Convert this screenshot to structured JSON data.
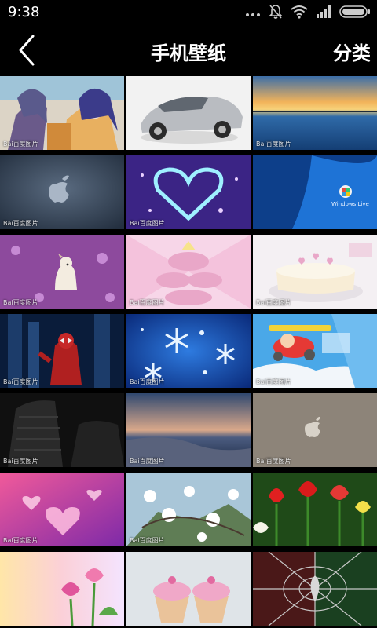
{
  "status_bar": {
    "time": "9:38",
    "icons": [
      "more-dots-icon",
      "mute-bell-icon",
      "wifi-icon",
      "signal-icon",
      "battery-icon"
    ]
  },
  "nav": {
    "back_icon": "chevron-left-icon",
    "title": "手机壁纸",
    "category_label": "分类"
  },
  "wallpapers": [
    {
      "subject": "anime-girls",
      "watermark": "Bai百度图片"
    },
    {
      "subject": "silver-sports-car",
      "watermark": ""
    },
    {
      "subject": "ocean-sunset-reflection",
      "watermark": "Bai百度图片"
    },
    {
      "subject": "apple-logo-gray",
      "watermark": "Bai百度图片"
    },
    {
      "subject": "glowing-heart",
      "watermark": "Bai百度图片"
    },
    {
      "subject": "windows-live-blue",
      "watermark": "",
      "caption": "Windows Live"
    },
    {
      "subject": "dog-in-flowers",
      "watermark": "Bai百度图片"
    },
    {
      "subject": "pink-cartoon-castle",
      "watermark": "Bai百度图片"
    },
    {
      "subject": "heart-cake",
      "watermark": "Bai百度图片"
    },
    {
      "subject": "spiderman-city",
      "watermark": "Bai百度图片"
    },
    {
      "subject": "snowflakes-blue",
      "watermark": "Bai百度图片"
    },
    {
      "subject": "cartoon-plane",
      "watermark": "Bai百度图片"
    },
    {
      "subject": "car-seats",
      "watermark": "Bai百度图片"
    },
    {
      "subject": "coast-dusk",
      "watermark": "Bai百度图片"
    },
    {
      "subject": "apple-logo-taupe",
      "watermark": "Bai百度图片"
    },
    {
      "subject": "pink-hearts",
      "watermark": "Bai百度图片"
    },
    {
      "subject": "white-blossoms",
      "watermark": "Bai百度图片"
    },
    {
      "subject": "red-tulips",
      "watermark": ""
    },
    {
      "subject": "pink-tulips",
      "watermark": ""
    },
    {
      "subject": "cupcakes",
      "watermark": ""
    },
    {
      "subject": "spider-web-dark",
      "watermark": ""
    }
  ],
  "colors": {
    "background": "#000000",
    "text": "#ffffff"
  }
}
